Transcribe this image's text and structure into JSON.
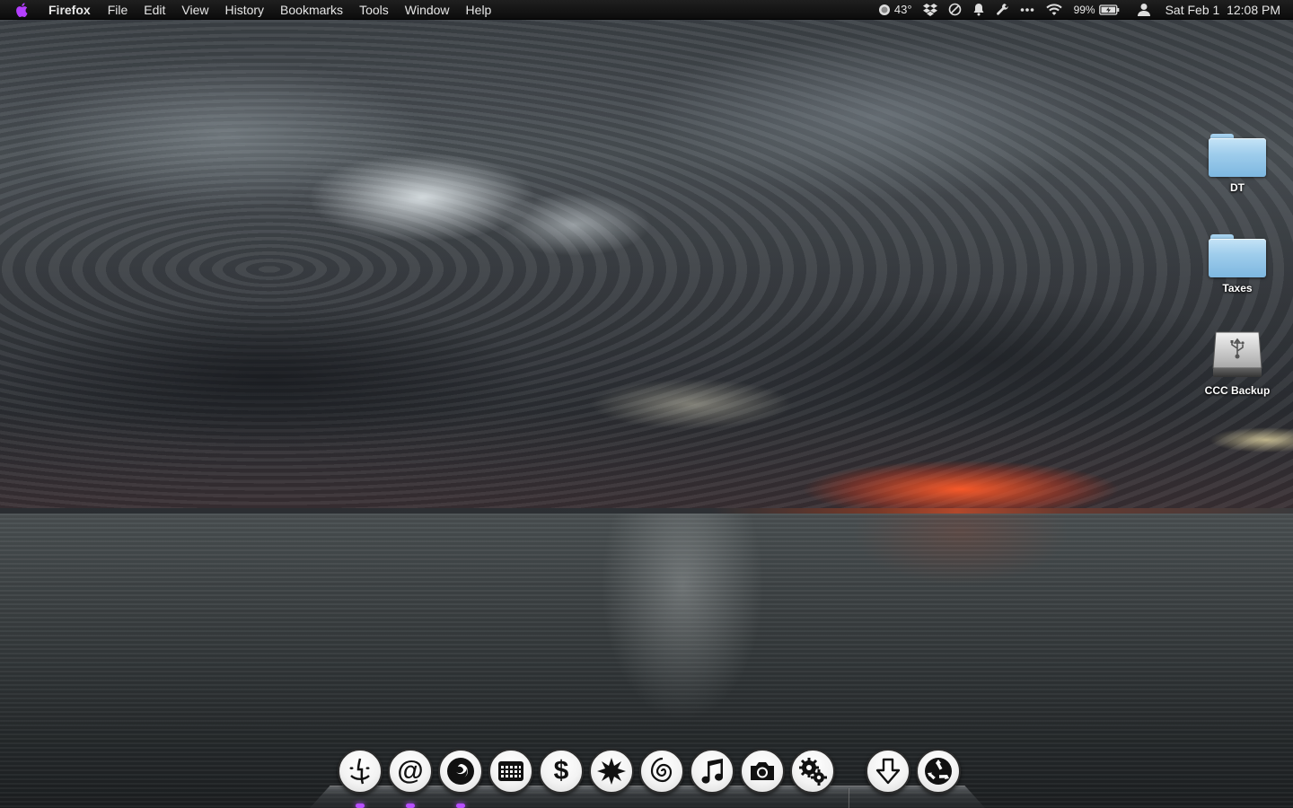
{
  "menubar": {
    "app_name": "Firefox",
    "menus": [
      "File",
      "Edit",
      "View",
      "History",
      "Bookmarks",
      "Tools",
      "Window",
      "Help"
    ],
    "status": {
      "weather": "43°",
      "battery": "99%",
      "clock": "Sat Feb 1  12:08 PM"
    },
    "status_icons": [
      "weather-icon",
      "dropbox-icon",
      "sync-icon",
      "notification-bell-icon",
      "wrench-icon",
      "more-icon",
      "wifi-icon",
      "battery-icon",
      "user-icon"
    ]
  },
  "desktop": {
    "icons": [
      {
        "label": "DT",
        "kind": "folder"
      },
      {
        "label": "Taxes",
        "kind": "folder"
      },
      {
        "label": "CCC Backup",
        "kind": "usb-drive"
      }
    ]
  },
  "dock": {
    "apps": [
      "finder",
      "mail",
      "firefox",
      "calendar",
      "money",
      "starburst",
      "spiral",
      "music",
      "camera",
      "settings"
    ],
    "stacks": [
      "downloads",
      "trash"
    ],
    "running_indicator_color": "#b84dff"
  },
  "colors": {
    "menubar_bg": "#111111",
    "menubar_text": "#e6e6e6",
    "folder_blue": "#9fcdec"
  }
}
